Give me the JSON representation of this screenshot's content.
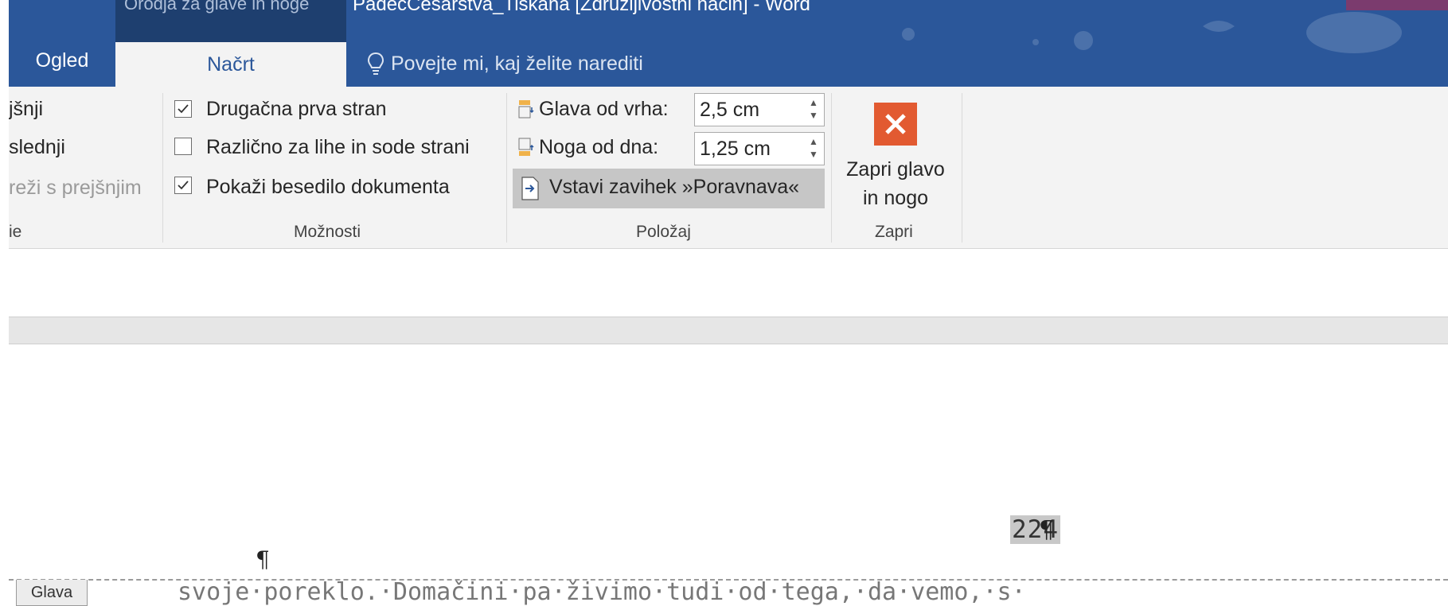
{
  "titlebar": {
    "contextual_label": "Orodja za glave in noge",
    "doc_title": "PadecCesarstva_Tiskana [Združljivostni način] - Word"
  },
  "tabs": {
    "ogled": "Ogled",
    "nacrt": "Načrt",
    "tellme": "Povejte mi, kaj želite narediti"
  },
  "ribbon": {
    "nav_group": {
      "item1": "jšnji",
      "item2": "slednji",
      "item3": "reži s prejšnjim",
      "label": "ie"
    },
    "moznosti": {
      "label": "Možnosti",
      "opt1": {
        "text": "Drugačna prva stran",
        "checked": true
      },
      "opt2": {
        "text": "Različno za lihe in sode strani",
        "checked": false
      },
      "opt3": {
        "text": "Pokaži besedilo dokumenta",
        "checked": true
      }
    },
    "polozaj": {
      "label": "Položaj",
      "header_from_top_label": "Glava od vrha:",
      "header_from_top_value": "2,5 cm",
      "footer_from_bottom_label": "Noga od dna:",
      "footer_from_bottom_value": "1,25 cm",
      "insert_align_tab": "Vstavi zavihek »Poravnava«"
    },
    "zapri": {
      "label": "Zapri",
      "close_line1": "Zapri glavo",
      "close_line2": "in nogo"
    }
  },
  "document": {
    "page_number": "224",
    "pilcrow": "¶",
    "header_tag": "Glava",
    "body_text": "svoje·poreklo.·Domačini·pa·živimo·tudi·od·tega,·da·vemo,·s·"
  },
  "colors": {
    "accent": "#2b579a",
    "close_button": "#e25a31"
  }
}
